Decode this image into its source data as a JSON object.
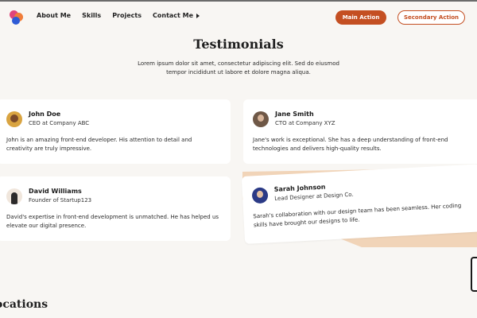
{
  "nav": {
    "links": [
      "About Me",
      "Skills",
      "Projects",
      "Contact Me"
    ],
    "main_action": "Main Action",
    "secondary_action": "Secondary Action"
  },
  "header": {
    "title": "Testimonials",
    "subtitle": "Lorem ipsum dolor sit amet, consectetur adipiscing elit. Sed do eiusmod tempor incididunt ut labore et dolore magna aliqua."
  },
  "testimonials": [
    {
      "name": "John Doe",
      "role": "CEO at Company ABC",
      "text": "John is an amazing front-end developer. His attention to detail and creativity are truly impressive."
    },
    {
      "name": "Jane Smith",
      "role": "CTO at Company XYZ",
      "text": "Jane's work is exceptional. She has a deep understanding of front-end technologies and delivers high-quality results."
    },
    {
      "name": "David Williams",
      "role": "Founder of Startup123",
      "text": "David's expertise in front-end development is unmatched. He has helped us elevate our digital presence."
    },
    {
      "name": "Sarah Johnson",
      "role": "Lead Designer at Design Co.",
      "text": "Sarah's collaboration with our design team has been seamless. Her coding skills have brought our designs to life."
    }
  ],
  "sections": {
    "locations_title": "ocations"
  },
  "colors": {
    "accent": "#c44f22",
    "background": "#f8f6f3",
    "tilt_background": "#f1d4b8"
  }
}
